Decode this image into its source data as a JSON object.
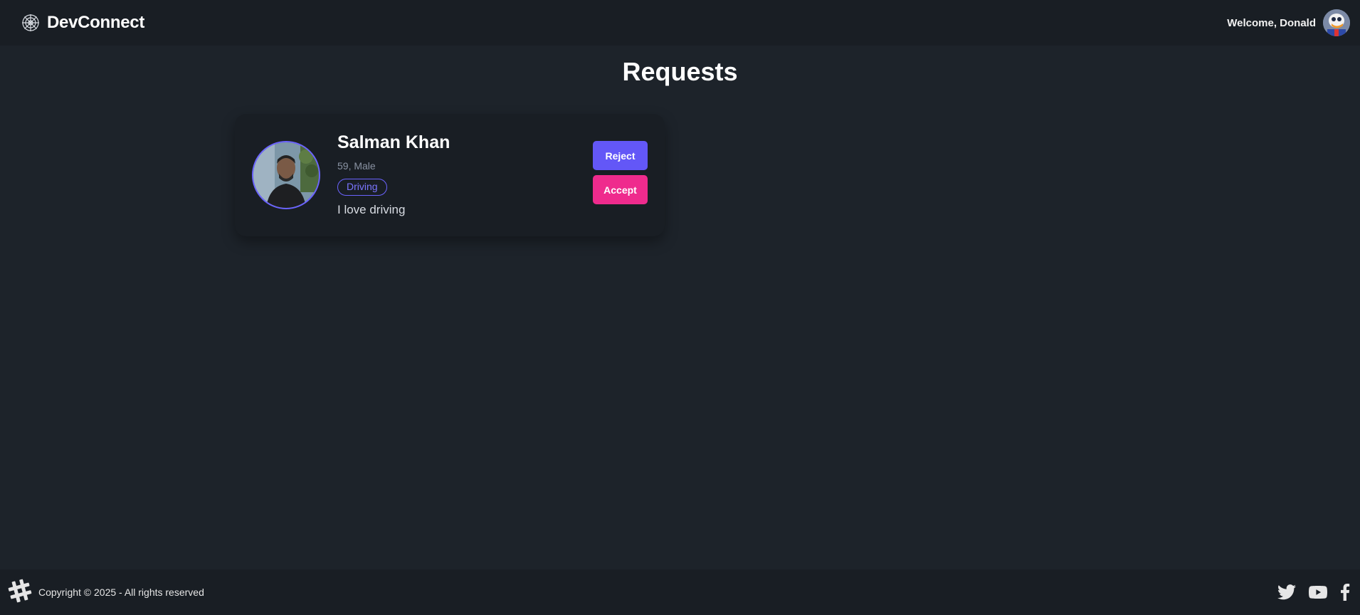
{
  "navbar": {
    "brand_name": "DevConnect",
    "brand_icon": "web-icon",
    "welcome_text": "Welcome, Donald",
    "avatar_icon": "user-avatar"
  },
  "page": {
    "title": "Requests"
  },
  "requests": [
    {
      "name": "Salman Khan",
      "meta": "59, Male",
      "skill": "Driving",
      "about": "I love driving",
      "reject_label": "Reject",
      "accept_label": "Accept"
    }
  ],
  "footer": {
    "logo_icon": "hash-icon",
    "copyright": "Copyright © 2025 - All rights reserved",
    "social_icons": [
      "twitter-icon",
      "youtube-icon",
      "facebook-icon"
    ]
  },
  "colors": {
    "background": "#1d232a",
    "bar": "#191e24",
    "primary": "#6357f7",
    "secondary": "#ef2b8d"
  }
}
